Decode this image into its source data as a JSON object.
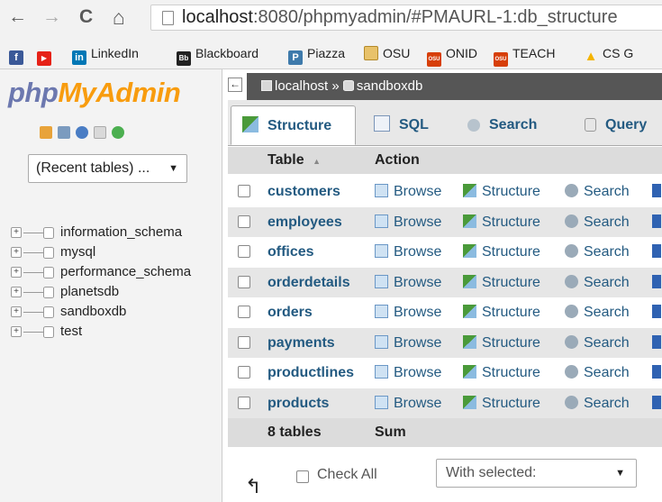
{
  "browser": {
    "back": "←",
    "forward": "→",
    "reload": "C",
    "home": "⌂",
    "url_host": "localhost",
    "url_path": ":8080/phpmyadmin/#PMAURL-1:db_structure"
  },
  "bookmarks": [
    {
      "label": "",
      "icon": "facebook-icon",
      "color": "#3b5998",
      "glyph": "f"
    },
    {
      "label": "",
      "icon": "youtube-icon",
      "color": "#e62117",
      "glyph": "▶"
    },
    {
      "label": "LinkedIn",
      "icon": "linkedin-icon",
      "color": "#0077b5",
      "glyph": "in"
    },
    {
      "label": "Blackboard",
      "icon": "blackboard-icon",
      "color": "#222222",
      "glyph": "Bb"
    },
    {
      "label": "Piazza",
      "icon": "piazza-icon",
      "color": "#3e7aab",
      "glyph": "P"
    },
    {
      "label": "OSU",
      "icon": "folder-icon",
      "color": "#e8c26a",
      "glyph": ""
    },
    {
      "label": "ONID",
      "icon": "osu-icon",
      "color": "#d73f09",
      "glyph": "OSU"
    },
    {
      "label": "TEACH",
      "icon": "osu-coe-icon",
      "color": "#d73f09",
      "glyph": "OSU"
    },
    {
      "label": "CS G",
      "icon": "google-drive-icon",
      "color": "#f4b400",
      "glyph": "▲"
    }
  ],
  "logo": {
    "php": "php",
    "myadmin": "MyAdmin"
  },
  "recent_tables": "(Recent tables) ...",
  "databases": [
    "information_schema",
    "mysql",
    "performance_schema",
    "planetsdb",
    "sandboxdb",
    "test"
  ],
  "breadcrumb": {
    "server": "localhost",
    "separator": "»",
    "database": "sandboxdb"
  },
  "tabs": [
    {
      "label": "Structure",
      "icon": "structure-icon"
    },
    {
      "label": "SQL",
      "icon": "sql-icon"
    },
    {
      "label": "Search",
      "icon": "search-icon"
    },
    {
      "label": "Query",
      "icon": "query-icon"
    }
  ],
  "table_header": {
    "table": "Table",
    "sort_indicator": "▲",
    "action": "Action"
  },
  "actions": {
    "browse": "Browse",
    "structure": "Structure",
    "search": "Search"
  },
  "tables": [
    "customers",
    "employees",
    "offices",
    "orderdetails",
    "orders",
    "payments",
    "productlines",
    "products"
  ],
  "footer": {
    "count": "8 tables",
    "sum": "Sum"
  },
  "bottom": {
    "arrow": "↰",
    "check_all": "Check All",
    "with_selected": "With selected:",
    "dropdown_arrow": "▼"
  }
}
